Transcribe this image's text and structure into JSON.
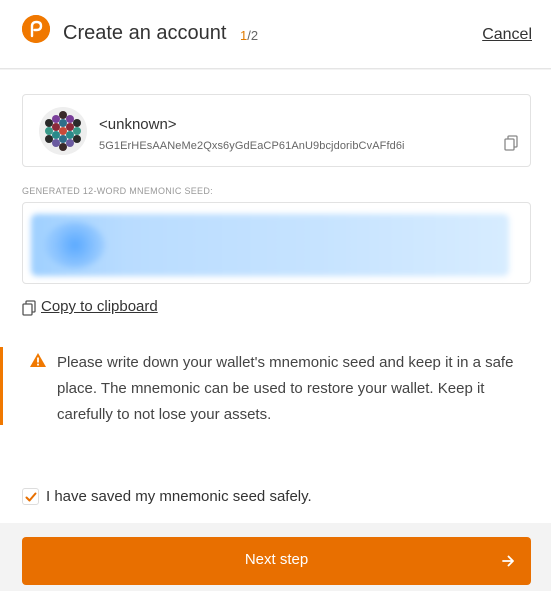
{
  "header": {
    "title": "Create an account",
    "step_current": "1",
    "step_total": "/2",
    "cancel_label": "Cancel"
  },
  "account": {
    "name": "<unknown>",
    "address": "5G1ErHEsAANeMe2Qxs6yGdEaCP61AnU9bcjdoribCvAFfd6i"
  },
  "seed": {
    "label": "GENERATED 12-WORD MNEMONIC SEED:",
    "blurred": true
  },
  "copy_label": "Copy to clipboard",
  "warning": {
    "text": "Please write down your wallet's mnemonic seed and keep it in a safe place. The mnemonic can be used to restore your wallet. Keep it carefully to not lose your assets."
  },
  "confirm": {
    "label": "I have saved my mnemonic seed safely.",
    "checked": true
  },
  "next_button_label": "Next step",
  "colors": {
    "accent": "#e86f00",
    "warning_icon": "#f07800"
  },
  "icons": {
    "logo": "polkadot-logo-icon",
    "copy": "copy-icon",
    "warning": "warning-icon",
    "check": "check-icon",
    "arrow": "arrow-right-icon"
  }
}
